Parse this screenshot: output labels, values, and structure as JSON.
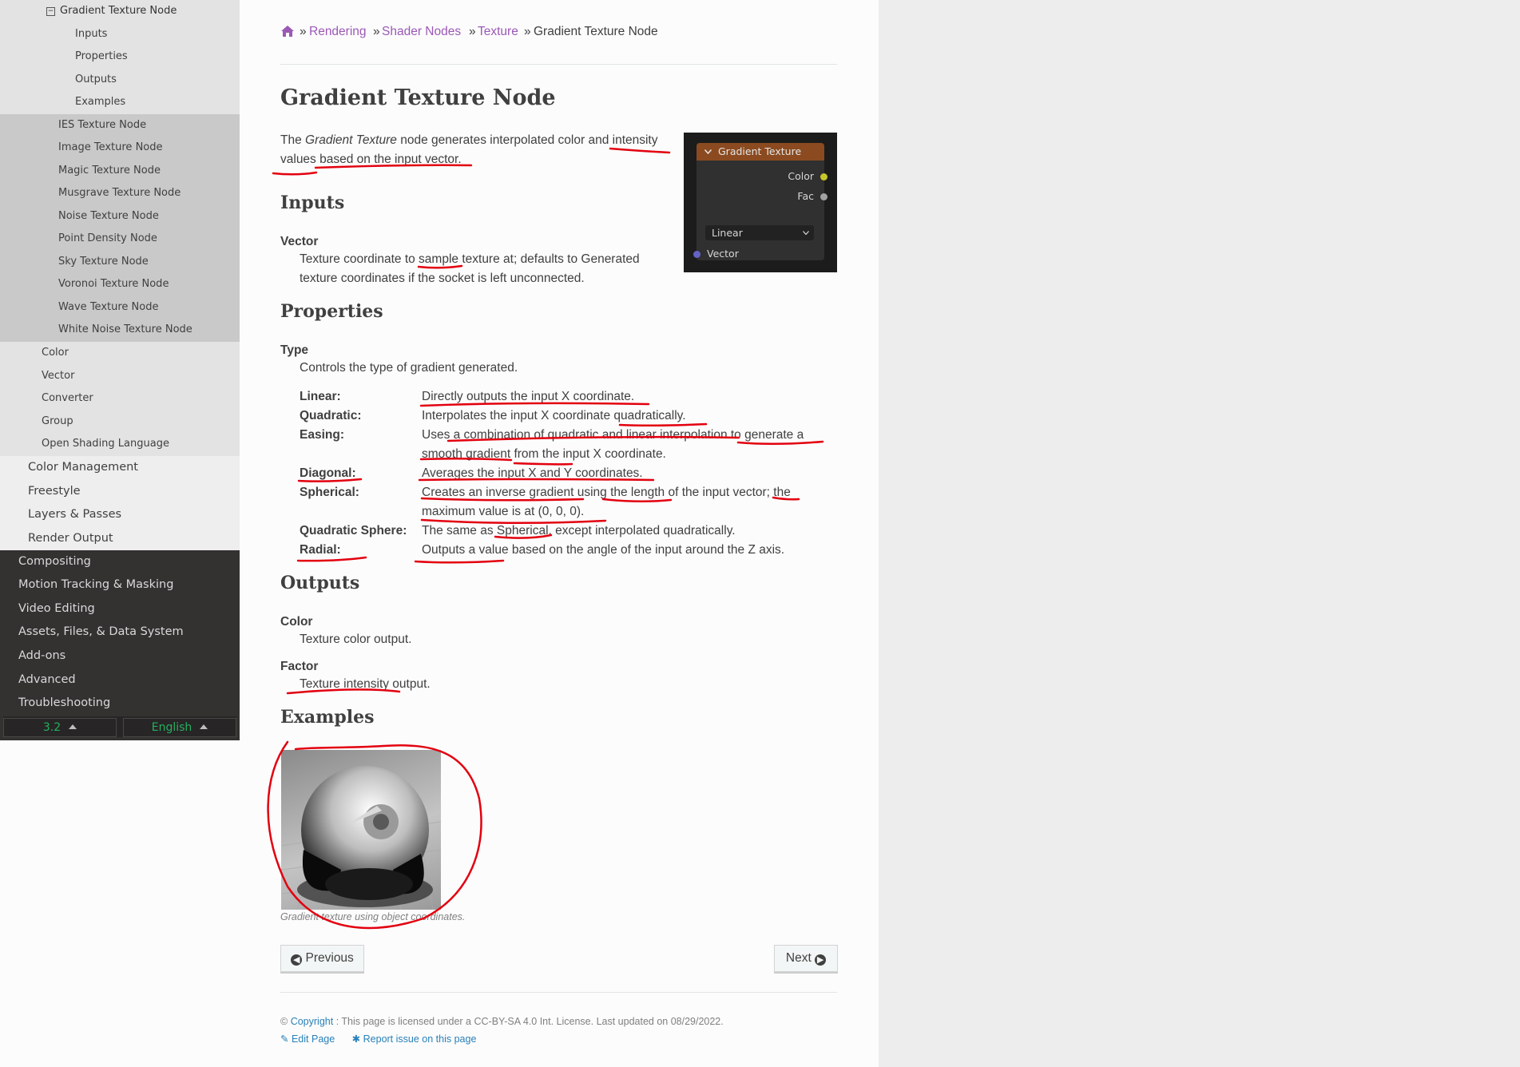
{
  "sidebar": {
    "current_section": "Gradient Texture Node",
    "current_subitems": [
      "Inputs",
      "Properties",
      "Outputs",
      "Examples"
    ],
    "texture_nodes": [
      "IES Texture Node",
      "Image Texture Node",
      "Magic Texture Node",
      "Musgrave Texture Node",
      "Noise Texture Node",
      "Point Density Node",
      "Sky Texture Node",
      "Voronoi Texture Node",
      "Wave Texture Node",
      "White Noise Texture Node"
    ],
    "shader_groups": [
      "Color",
      "Vector",
      "Converter",
      "Group",
      "Open Shading Language"
    ],
    "rendering_items": [
      "Color Management",
      "Freestyle",
      "Layers & Passes",
      "Render Output"
    ],
    "top_items": [
      "Compositing",
      "Motion Tracking & Masking",
      "Video Editing",
      "Assets, Files, & Data System",
      "Add-ons",
      "Advanced",
      "Troubleshooting"
    ],
    "version": "3.2",
    "language": "English"
  },
  "breadcrumb": {
    "home_icon": "home-icon",
    "sep": "»",
    "items": [
      "Rendering",
      "Shader Nodes",
      "Texture"
    ],
    "current": "Gradient Texture Node"
  },
  "page": {
    "title": "Gradient Texture Node",
    "intro_prefix": "The ",
    "intro_italic": "Gradient Texture",
    "intro_line1_rest": " node generates interpolated color and intensity",
    "intro_line2": "values based on the input vector.",
    "inputs_heading": "Inputs",
    "vector_term": "Vector",
    "vector_desc_line1": "Texture coordinate to sample texture at; defaults to Generated",
    "vector_desc_line2": "texture coordinates if the socket is left unconnected.",
    "properties_heading": "Properties",
    "type_term": "Type",
    "type_desc": "Controls the type of gradient generated.",
    "types": [
      {
        "name": "Linear:",
        "desc": [
          "Directly outputs the input X coordinate."
        ]
      },
      {
        "name": "Quadratic:",
        "desc": [
          "Interpolates the input X coordinate quadratically."
        ]
      },
      {
        "name": "Easing:",
        "desc": [
          "Uses a combination of quadratic and linear interpolation to generate a",
          "smooth gradient from the input X coordinate."
        ]
      },
      {
        "name": "Diagonal:",
        "desc": [
          "Averages the input X and Y coordinates."
        ]
      },
      {
        "name": "Spherical:",
        "desc": [
          "Creates an inverse gradient using the length of the input vector; the",
          "maximum value is at (0, 0, 0)."
        ]
      },
      {
        "name": "Quadratic Sphere:",
        "desc": [
          "The same as Spherical, except interpolated quadratically."
        ]
      },
      {
        "name": "Radial:",
        "desc": [
          "Outputs a value based on the angle of the input around the Z axis."
        ]
      }
    ],
    "outputs_heading": "Outputs",
    "color_term": "Color",
    "color_desc": "Texture color output.",
    "factor_term": "Factor",
    "factor_desc": "Texture intensity output.",
    "examples_heading": "Examples",
    "example_caption": "Gradient texture using object coordinates.",
    "prev_label": "Previous",
    "next_label": "Next"
  },
  "node_ui": {
    "title": "Gradient Texture",
    "out_color": "Color",
    "out_fac": "Fac",
    "dropdown_value": "Linear",
    "in_vector": "Vector",
    "socket_colors": {
      "color": "#c7c729",
      "fac": "#a1a1a1",
      "vector": "#6363c7"
    }
  },
  "footer": {
    "copyright_symbol": "©",
    "copyright_link": "Copyright",
    "license_text": ": This page is licensed under a CC-BY-SA 4.0 Int. License. Last updated on 08/29/2022.",
    "edit_page": "Edit Page",
    "report_issue": "Report issue on this page"
  },
  "colors": {
    "link": "#9b59b6",
    "footer_link": "#2980b9",
    "version_green": "#27ae60",
    "annotation_red": "#e3000f"
  }
}
